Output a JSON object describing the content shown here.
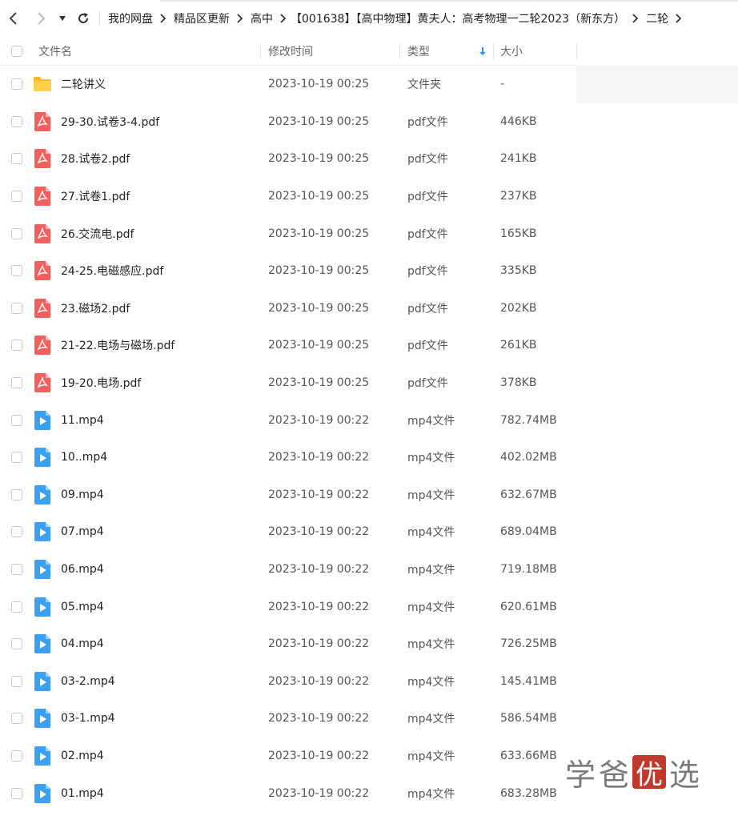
{
  "toolbar": {
    "back_icon": "back-arrow-icon",
    "forward_icon": "forward-arrow-icon",
    "dropdown_icon": "caret-down-icon",
    "refresh_icon": "refresh-icon"
  },
  "breadcrumb": [
    "我的网盘",
    "精品区更新",
    "高中",
    "【001638】【高中物理】黄夫人：高考物理一二轮2023（新东方）",
    "二轮"
  ],
  "columns": {
    "name": "文件名",
    "modified": "修改时间",
    "type": "类型",
    "size": "大小"
  },
  "files": [
    {
      "icon": "folder-icon",
      "name": "二轮讲义",
      "modified": "2023-10-19 00:25",
      "type": "文件夹",
      "size": "-"
    },
    {
      "icon": "pdf-icon",
      "name": "29-30.试卷3-4.pdf",
      "modified": "2023-10-19 00:25",
      "type": "pdf文件",
      "size": "446KB"
    },
    {
      "icon": "pdf-icon",
      "name": "28.试卷2.pdf",
      "modified": "2023-10-19 00:25",
      "type": "pdf文件",
      "size": "241KB"
    },
    {
      "icon": "pdf-icon",
      "name": "27.试卷1.pdf",
      "modified": "2023-10-19 00:25",
      "type": "pdf文件",
      "size": "237KB"
    },
    {
      "icon": "pdf-icon",
      "name": "26.交流电.pdf",
      "modified": "2023-10-19 00:25",
      "type": "pdf文件",
      "size": "165KB"
    },
    {
      "icon": "pdf-icon",
      "name": "24-25.电磁感应.pdf",
      "modified": "2023-10-19 00:25",
      "type": "pdf文件",
      "size": "335KB"
    },
    {
      "icon": "pdf-icon",
      "name": "23.磁场2.pdf",
      "modified": "2023-10-19 00:25",
      "type": "pdf文件",
      "size": "202KB"
    },
    {
      "icon": "pdf-icon",
      "name": "21-22.电场与磁场.pdf",
      "modified": "2023-10-19 00:25",
      "type": "pdf文件",
      "size": "261KB"
    },
    {
      "icon": "pdf-icon",
      "name": "19-20.电场.pdf",
      "modified": "2023-10-19 00:25",
      "type": "pdf文件",
      "size": "378KB"
    },
    {
      "icon": "video-icon",
      "name": "11.mp4",
      "modified": "2023-10-19 00:22",
      "type": "mp4文件",
      "size": "782.74MB"
    },
    {
      "icon": "video-icon",
      "name": "10..mp4",
      "modified": "2023-10-19 00:22",
      "type": "mp4文件",
      "size": "402.02MB"
    },
    {
      "icon": "video-icon",
      "name": "09.mp4",
      "modified": "2023-10-19 00:22",
      "type": "mp4文件",
      "size": "632.67MB"
    },
    {
      "icon": "video-icon",
      "name": "07.mp4",
      "modified": "2023-10-19 00:22",
      "type": "mp4文件",
      "size": "689.04MB"
    },
    {
      "icon": "video-icon",
      "name": "06.mp4",
      "modified": "2023-10-19 00:22",
      "type": "mp4文件",
      "size": "719.18MB"
    },
    {
      "icon": "video-icon",
      "name": "05.mp4",
      "modified": "2023-10-19 00:22",
      "type": "mp4文件",
      "size": "620.61MB"
    },
    {
      "icon": "video-icon",
      "name": "04.mp4",
      "modified": "2023-10-19 00:22",
      "type": "mp4文件",
      "size": "726.25MB"
    },
    {
      "icon": "video-icon",
      "name": "03-2.mp4",
      "modified": "2023-10-19 00:22",
      "type": "mp4文件",
      "size": "145.41MB"
    },
    {
      "icon": "video-icon",
      "name": "03-1.mp4",
      "modified": "2023-10-19 00:22",
      "type": "mp4文件",
      "size": "586.54MB"
    },
    {
      "icon": "video-icon",
      "name": "02.mp4",
      "modified": "2023-10-19 00:22",
      "type": "mp4文件",
      "size": "633.66MB"
    },
    {
      "icon": "video-icon",
      "name": "01.mp4",
      "modified": "2023-10-19 00:22",
      "type": "mp4文件",
      "size": "683.28MB"
    }
  ],
  "watermark": {
    "text_1": "学",
    "text_2": "爸",
    "text_3": "优",
    "text_4": "选"
  },
  "colors": {
    "pdf": "#f25f5c",
    "video": "#3aa0f3",
    "folder": "#f7b928",
    "sort_arrow": "#2f8ef0"
  }
}
